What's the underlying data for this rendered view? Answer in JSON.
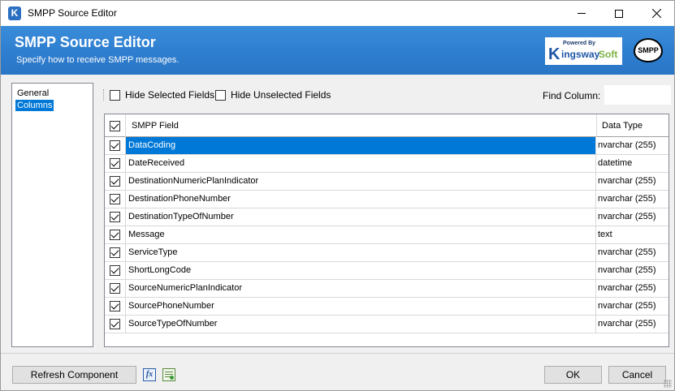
{
  "window": {
    "title": "SMPP Source Editor",
    "app_icon": "K"
  },
  "banner": {
    "title": "SMPP Source Editor",
    "subtitle": "Specify how to receive SMPP messages.",
    "logo_powered": "Powered By",
    "logo_k": "K",
    "logo_kingsway": "ingsway",
    "logo_soft": "Soft",
    "badge": "SMPP",
    "color": "#2f7fd0"
  },
  "nav": {
    "items": [
      {
        "label": "General",
        "selected": false
      },
      {
        "label": "Columns",
        "selected": true
      }
    ]
  },
  "toolbar": {
    "hide_selected": "Hide Selected Fields",
    "hide_unselected": "Hide Unselected Fields",
    "find_label": "Find Column:",
    "find_value": ""
  },
  "grid": {
    "headers": {
      "field": "SMPP Field",
      "type": "Data Type"
    },
    "rows": [
      {
        "field": "DataCoding",
        "type": "nvarchar (255)",
        "checked": true,
        "selected": true
      },
      {
        "field": "DateReceived",
        "type": "datetime",
        "checked": true,
        "selected": false
      },
      {
        "field": "DestinationNumericPlanIndicator",
        "type": "nvarchar (255)",
        "checked": true,
        "selected": false
      },
      {
        "field": "DestinationPhoneNumber",
        "type": "nvarchar (255)",
        "checked": true,
        "selected": false
      },
      {
        "field": "DestinationTypeOfNumber",
        "type": "nvarchar (255)",
        "checked": true,
        "selected": false
      },
      {
        "field": "Message",
        "type": "text",
        "checked": true,
        "selected": false
      },
      {
        "field": "ServiceType",
        "type": "nvarchar (255)",
        "checked": true,
        "selected": false
      },
      {
        "field": "ShortLongCode",
        "type": "nvarchar (255)",
        "checked": true,
        "selected": false
      },
      {
        "field": "SourceNumericPlanIndicator",
        "type": "nvarchar (255)",
        "checked": true,
        "selected": false
      },
      {
        "field": "SourcePhoneNumber",
        "type": "nvarchar (255)",
        "checked": true,
        "selected": false
      },
      {
        "field": "SourceTypeOfNumber",
        "type": "nvarchar (255)",
        "checked": true,
        "selected": false
      }
    ]
  },
  "buttons": {
    "refresh": "Refresh Component",
    "fx": "fx",
    "ok": "OK",
    "cancel": "Cancel"
  },
  "colors": {
    "selection": "#0078d7",
    "banner": "#2f7fd0"
  }
}
